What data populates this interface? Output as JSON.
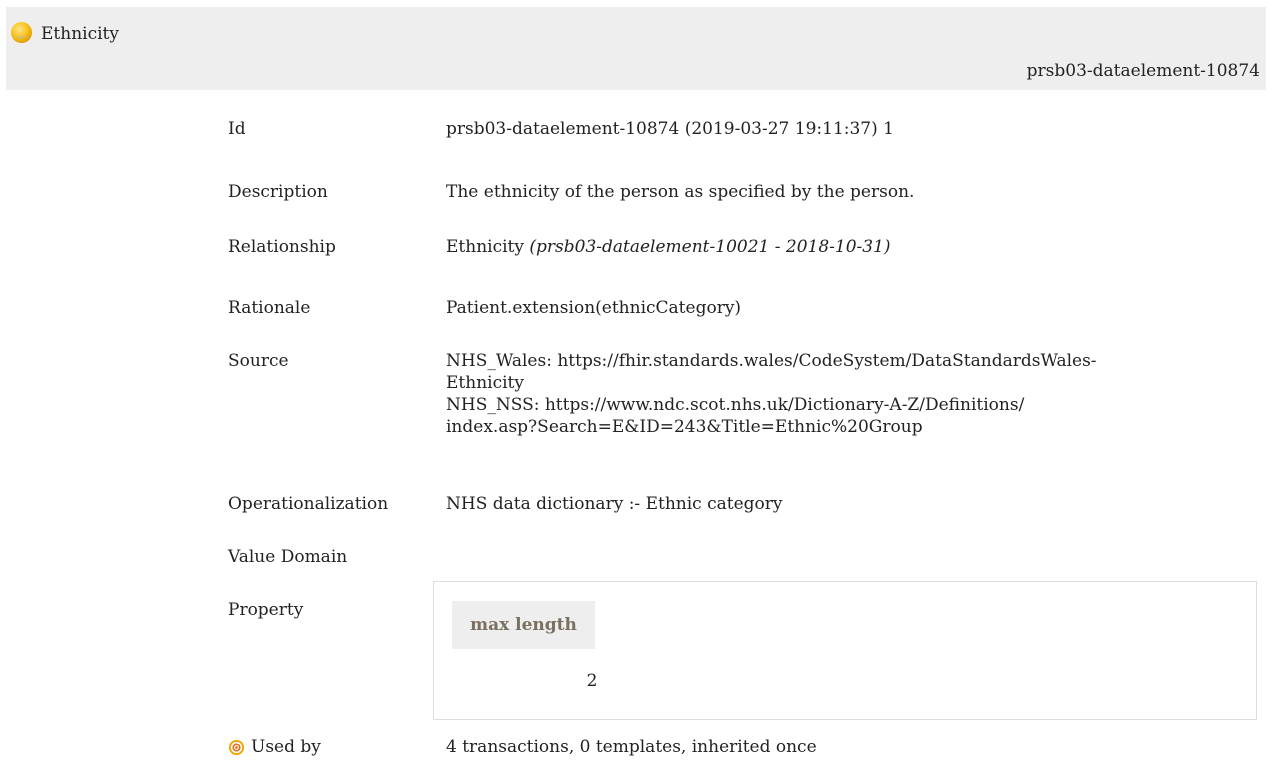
{
  "header": {
    "title": "Ethnicity",
    "id": "prsb03-dataelement-10874",
    "status_icon": "status-circle-icon",
    "status_color": "#f5b400"
  },
  "details": {
    "id_label": "Id",
    "id_value": "prsb03-dataelement-10874 (2019-03-27 19:11:37) 1",
    "description_label": "Description",
    "description_value": "The ethnicity of the person as specified by the person.",
    "relationship_label": "Relationship",
    "relationship_value": "Ethnicity",
    "relationship_ref": "(prsb03-dataelement-10021 - 2018-10-31)",
    "rationale_label": "Rationale",
    "rationale_value": "Patient.extension(ethnicCategory)",
    "source_label": "Source",
    "source_lines": [
      "NHS_Wales: https://fhir.standards.wales/CodeSystem/DataStandardsWales-",
      "Ethnicity",
      "NHS_NSS: https://www.ndc.scot.nhs.uk/Dictionary-A-Z/Definitions/",
      "index.asp?Search=E&ID=243&Title=Ethnic%20Group"
    ],
    "operationalization_label": "Operationalization",
    "operationalization_value": "NHS data dictionary :- Ethnic category",
    "value_domain_label": "Value Domain",
    "property_label": "Property",
    "property_header": "max length",
    "property_value": "2",
    "used_by_label": "Used by",
    "used_by_icon": "target-icon",
    "used_by_value": "4 transactions, 0 templates, inherited once"
  }
}
